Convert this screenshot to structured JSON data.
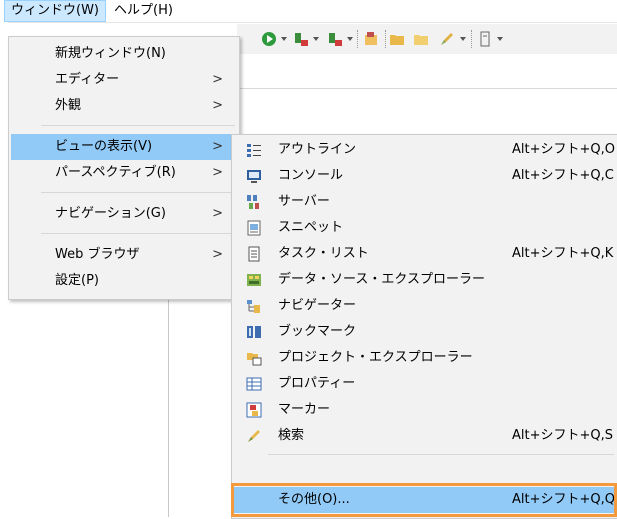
{
  "menubar": {
    "items": [
      {
        "label": "ウィンドウ(W)"
      },
      {
        "label": "ヘルプ(H)"
      }
    ]
  },
  "window_menu": {
    "items": [
      {
        "label": "新規ウィンドウ(N)"
      },
      {
        "label": "エディター"
      },
      {
        "label": "外観"
      },
      {
        "label": "ビューの表示(V)"
      },
      {
        "label": "パースペクティブ(R)"
      },
      {
        "label": "ナビゲーション(G)"
      },
      {
        "label": "Web ブラウザ"
      },
      {
        "label": "設定(P)"
      }
    ],
    "submenu_arrow": ">"
  },
  "show_view_submenu": {
    "items": [
      {
        "label": "アウトライン",
        "accel": "Alt+シフト+Q,O",
        "icon": "outline-icon"
      },
      {
        "label": "コンソール",
        "accel": "Alt+シフト+Q,C",
        "icon": "console-icon"
      },
      {
        "label": "サーバー",
        "accel": "",
        "icon": "servers-icon"
      },
      {
        "label": "スニペット",
        "accel": "",
        "icon": "snippets-icon"
      },
      {
        "label": "タスク・リスト",
        "accel": "Alt+シフト+Q,K",
        "icon": "task-list-icon"
      },
      {
        "label": "データ・ソース・エクスプローラー",
        "accel": "",
        "icon": "data-source-icon"
      },
      {
        "label": "ナビゲーター",
        "accel": "",
        "icon": "navigator-icon"
      },
      {
        "label": "ブックマーク",
        "accel": "",
        "icon": "bookmark-icon"
      },
      {
        "label": "プロジェクト・エクスプローラー",
        "accel": "",
        "icon": "project-explorer-icon"
      },
      {
        "label": "プロパティー",
        "accel": "",
        "icon": "properties-icon"
      },
      {
        "label": "マーカー",
        "accel": "",
        "icon": "markers-icon"
      },
      {
        "label": "検索",
        "accel": "Alt+シフト+Q,S",
        "icon": "search-icon"
      },
      {
        "label": "その他(O)...",
        "accel": "Alt+シフト+Q,Q",
        "icon": ""
      }
    ]
  },
  "colors": {
    "highlight": "#91c9f7",
    "focus_frame": "#f39a3e",
    "menu_bg": "#f2f2f2"
  }
}
